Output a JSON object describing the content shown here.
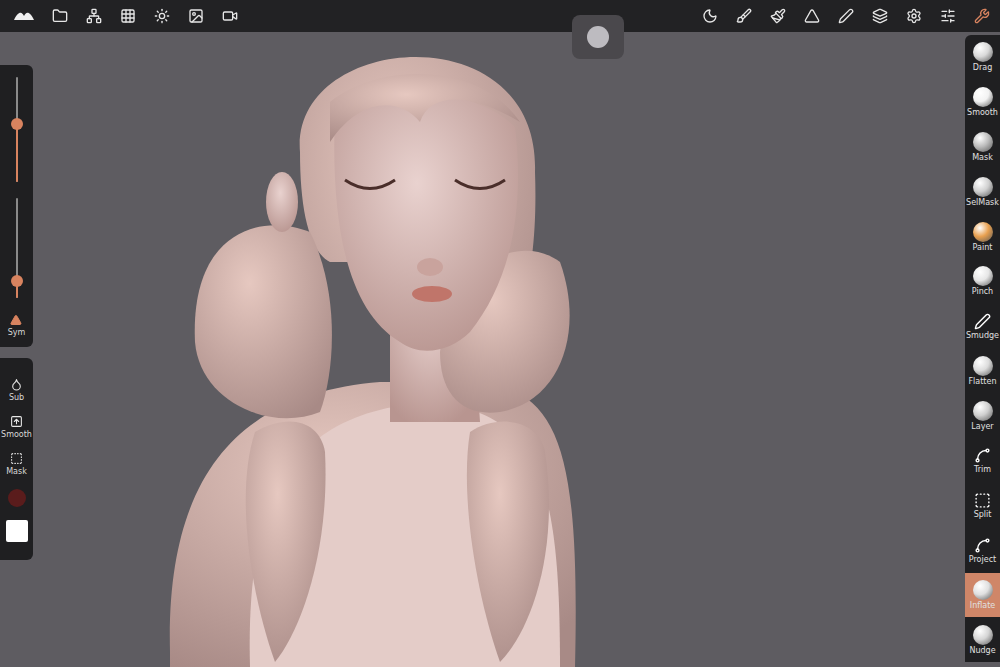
{
  "top_bar": {
    "tools_button_active": true
  },
  "left_panel": {
    "sliders": [
      {
        "level": 0.55
      },
      {
        "level": 0.17
      }
    ],
    "symmetry": {
      "label": "Sym",
      "on": true
    }
  },
  "quick_actions": [
    {
      "label": "Sub"
    },
    {
      "label": "Smooth"
    },
    {
      "label": "Mask"
    }
  ],
  "swatches": [
    {
      "color": "#5a1c1c"
    },
    {
      "color": "#ffffff"
    }
  ],
  "tools": [
    {
      "label": "Drag",
      "kind": "sphere",
      "color": "#d9d9d9",
      "selected": false
    },
    {
      "label": "Smooth",
      "kind": "sphere",
      "color": "#f2f2f2",
      "selected": false
    },
    {
      "label": "Mask",
      "kind": "sphere",
      "color": "#bdbdbd",
      "selected": false
    },
    {
      "label": "SelMask",
      "kind": "sphere",
      "color": "#d0d0d0",
      "selected": false
    },
    {
      "label": "Paint",
      "kind": "sphere",
      "color": "#e8a050",
      "selected": false
    },
    {
      "label": "Pinch",
      "kind": "sphere",
      "color": "#e6e6e6",
      "selected": false
    },
    {
      "label": "Smudge",
      "kind": "glyph",
      "color": "#ffffff",
      "selected": false
    },
    {
      "label": "Flatten",
      "kind": "sphere",
      "color": "#dcdcdc",
      "selected": false
    },
    {
      "label": "Layer",
      "kind": "sphere",
      "color": "#cfcfcf",
      "selected": false
    },
    {
      "label": "Trim",
      "kind": "glyph",
      "color": "#ffffff",
      "selected": false
    },
    {
      "label": "Split",
      "kind": "glyph",
      "color": "#ffffff",
      "selected": false
    },
    {
      "label": "Project",
      "kind": "glyph",
      "color": "#ffffff",
      "selected": false
    },
    {
      "label": "Inflate",
      "kind": "sphere",
      "color": "#e0e0e0",
      "selected": true
    },
    {
      "label": "Nudge",
      "kind": "sphere",
      "color": "#d5d5d5",
      "selected": false
    }
  ]
}
